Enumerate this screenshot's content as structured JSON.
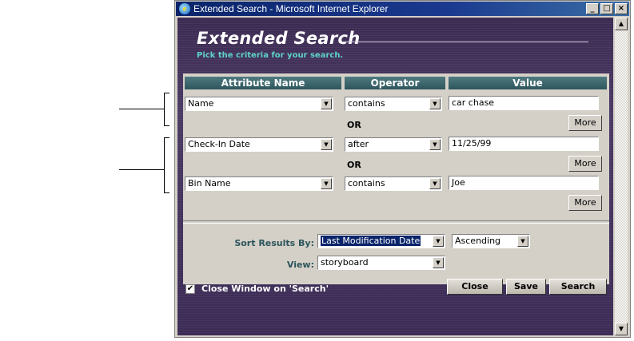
{
  "window": {
    "title": "Extended Search - Microsoft Internet Explorer",
    "controls": [
      "_",
      "□",
      "×"
    ]
  },
  "header": {
    "title": "Extended Search",
    "subtitle": "Pick the criteria for your search."
  },
  "columns": {
    "attribute": "Attribute Name",
    "operator": "Operator",
    "value": "Value"
  },
  "criteria": [
    {
      "attribute": "Name",
      "operator": "contains",
      "value": "car chase",
      "more": "More"
    },
    {
      "attribute": "Check-In Date",
      "operator": "after",
      "value": "11/25/99",
      "more": "More"
    },
    {
      "attribute": "Bin Name",
      "operator": "contains",
      "value": "Joe",
      "more": "More"
    }
  ],
  "connectors": [
    "OR",
    "OR"
  ],
  "sort": {
    "label": "Sort Results By:",
    "field": "Last Modification Date",
    "order": "Ascending"
  },
  "view": {
    "label": "View:",
    "value": "storyboard"
  },
  "footer": {
    "close_on_search_label": "Close Window on 'Search'",
    "close_on_search_checked": true,
    "checkmark": "✔",
    "close_button": "Close",
    "save_button": "Save",
    "search_button": "Search"
  },
  "icons": {
    "dropdown": "▼",
    "scroll_up": "▲",
    "scroll_down": "▼",
    "browser_logo": "e"
  },
  "colors": {
    "title_bar": "#0a246a",
    "content_bg": "#3b2a52",
    "subtitle": "#5fd3c9",
    "column_header": "#2d555c",
    "panel": "#d4d0c8"
  }
}
